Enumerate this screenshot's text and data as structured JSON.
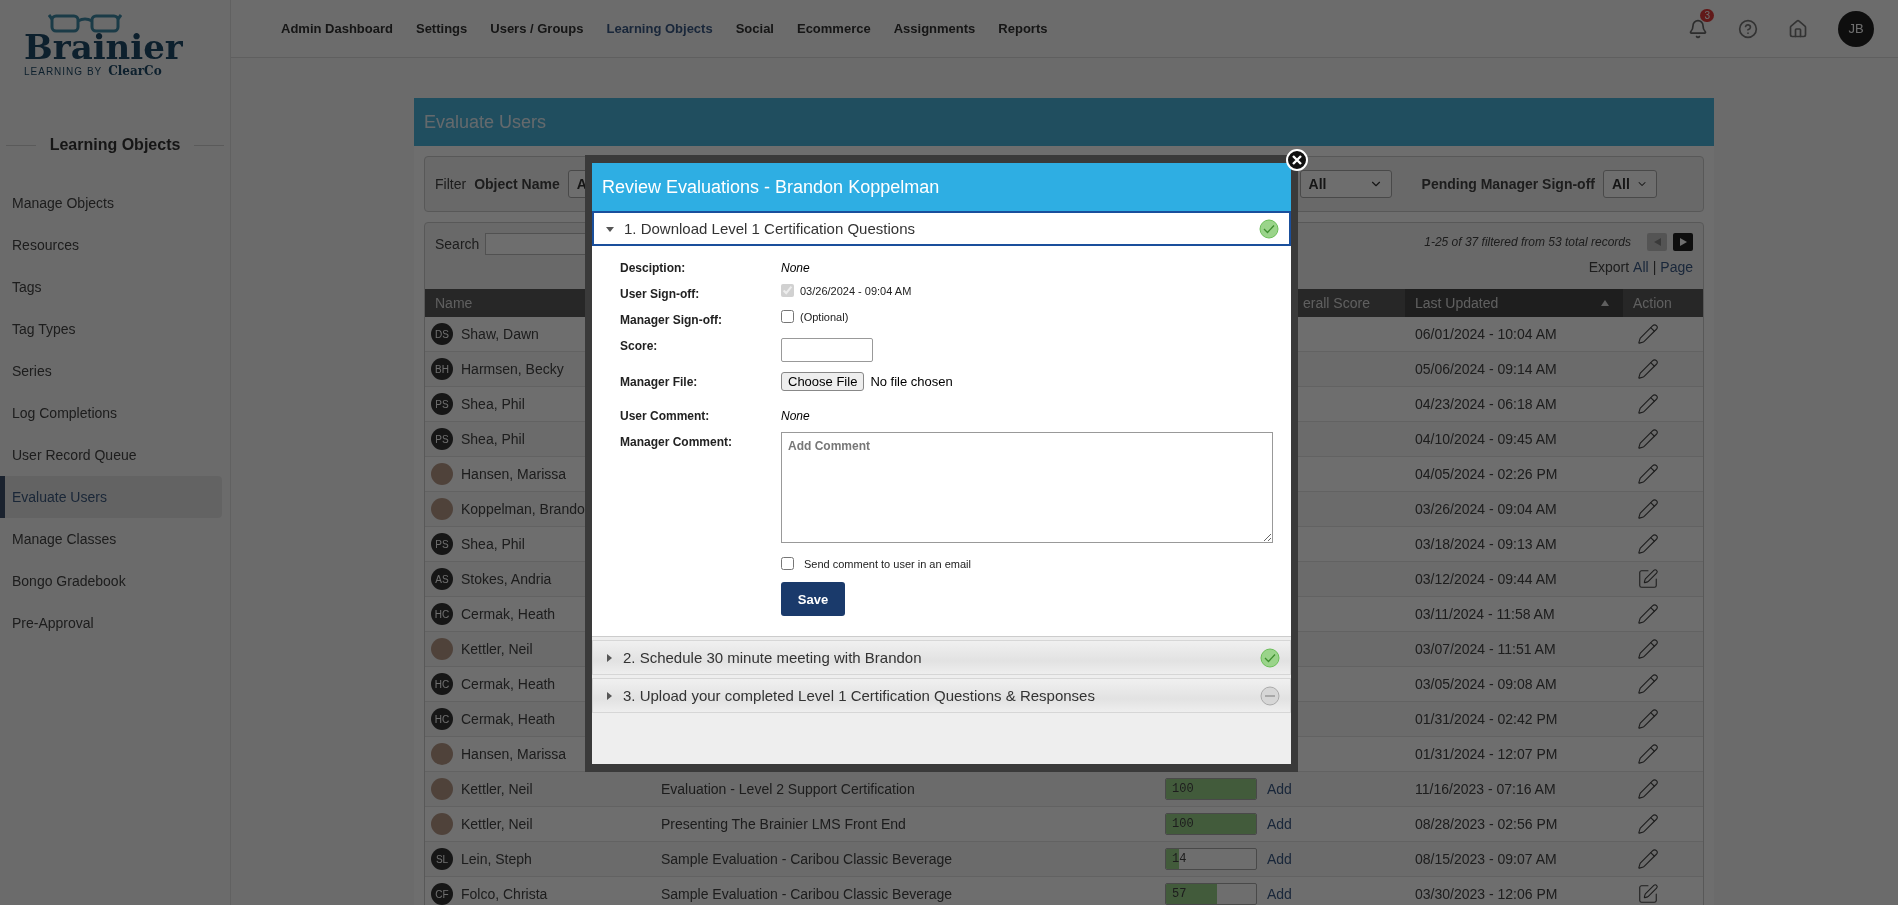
{
  "logo": {
    "name": "Brainier",
    "tagline": "LEARNING BY",
    "brand": "ClearCo"
  },
  "nav": [
    {
      "label": "Admin Dashboard",
      "selected": false
    },
    {
      "label": "Settings",
      "selected": false
    },
    {
      "label": "Users / Groups",
      "selected": false
    },
    {
      "label": "Learning Objects",
      "selected": true
    },
    {
      "label": "Social",
      "selected": false
    },
    {
      "label": "Ecommerce",
      "selected": false
    },
    {
      "label": "Assignments",
      "selected": false
    },
    {
      "label": "Reports",
      "selected": false
    }
  ],
  "topbar": {
    "notifications": "3",
    "user_initials": "JB"
  },
  "sidebar": {
    "heading": "Learning Objects",
    "items": [
      {
        "label": "Manage Objects",
        "selected": false
      },
      {
        "label": "Resources",
        "selected": false
      },
      {
        "label": "Tags",
        "selected": false
      },
      {
        "label": "Tag Types",
        "selected": false
      },
      {
        "label": "Series",
        "selected": false
      },
      {
        "label": "Log Completions",
        "selected": false
      },
      {
        "label": "User Record Queue",
        "selected": false
      },
      {
        "label": "Evaluate Users",
        "selected": true
      },
      {
        "label": "Manage Classes",
        "selected": false
      },
      {
        "label": "Bongo Gradebook",
        "selected": false
      },
      {
        "label": "Pre-Approval",
        "selected": false
      }
    ]
  },
  "panel": {
    "title": "Evaluate Users"
  },
  "filter": {
    "label": "Filter",
    "object_label": "Object Name",
    "object_value": "A",
    "status_value": "All",
    "pending_label": "Pending Manager Sign-off",
    "pending_value": "All"
  },
  "search": {
    "label": "Search"
  },
  "pager": {
    "summary": "1-25 of 37 filtered from 53 total records",
    "prev_disabled": true,
    "next_disabled": false
  },
  "export": {
    "label": "Export",
    "all": "All",
    "separator": "|",
    "page": "Page"
  },
  "table": {
    "columns": [
      "Name",
      "erall Score",
      "Last Updated",
      "Action"
    ],
    "rows": [
      {
        "name": "Shaw, Dawn",
        "avatar": {
          "kind": "initials",
          "text": "DS"
        },
        "updated": "06/01/2024 - 10:04 AM",
        "action": {
          "kind": "pencil"
        }
      },
      {
        "name": "Harmsen, Becky",
        "avatar": {
          "kind": "initials",
          "text": "BH"
        },
        "updated": "05/06/2024 - 09:14 AM",
        "action": {
          "kind": "pencil"
        }
      },
      {
        "name": "Shea, Phil",
        "avatar": {
          "kind": "initials",
          "text": "PS"
        },
        "updated": "04/23/2024 - 06:18 AM",
        "action": {
          "kind": "pencil"
        }
      },
      {
        "name": "Shea, Phil",
        "avatar": {
          "kind": "initials",
          "text": "PS"
        },
        "updated": "04/10/2024 - 09:45 AM",
        "action": {
          "kind": "pencil"
        }
      },
      {
        "name": "Hansen, Marissa",
        "avatar": {
          "kind": "photo"
        },
        "updated": "04/05/2024 - 02:26 PM",
        "action": {
          "kind": "pencil"
        }
      },
      {
        "name": "Koppelman, Brando",
        "avatar": {
          "kind": "photo"
        },
        "updated": "03/26/2024 - 09:04 AM",
        "action": {
          "kind": "pencil"
        }
      },
      {
        "name": "Shea, Phil",
        "avatar": {
          "kind": "initials",
          "text": "PS"
        },
        "updated": "03/18/2024 - 09:13 AM",
        "action": {
          "kind": "pencil"
        }
      },
      {
        "name": "Stokes, Andria",
        "avatar": {
          "kind": "initials",
          "text": "AS"
        },
        "updated": "03/12/2024 - 09:44 AM",
        "action": {
          "kind": "edit"
        }
      },
      {
        "name": "Cermak, Heath",
        "avatar": {
          "kind": "initials",
          "text": "HC"
        },
        "updated": "03/11/2024 - 11:58 AM",
        "action": {
          "kind": "pencil"
        }
      },
      {
        "name": "Kettler, Neil",
        "avatar": {
          "kind": "photo"
        },
        "updated": "03/07/2024 - 11:51 AM",
        "action": {
          "kind": "pencil"
        }
      },
      {
        "name": "Cermak, Heath",
        "avatar": {
          "kind": "initials",
          "text": "HC"
        },
        "updated": "03/05/2024 - 09:08 AM",
        "action": {
          "kind": "pencil"
        }
      },
      {
        "name": "Cermak, Heath",
        "avatar": {
          "kind": "initials",
          "text": "HC"
        },
        "updated": "01/31/2024 - 02:42 PM",
        "action": {
          "kind": "pencil"
        }
      },
      {
        "name": "Hansen, Marissa",
        "avatar": {
          "kind": "photo"
        },
        "updated": "01/31/2024 - 12:07 PM",
        "action": {
          "kind": "pencil"
        }
      },
      {
        "name": "Kettler, Neil",
        "avatar": {
          "kind": "photo"
        },
        "object": "Evaluation - Level 2 Support Certification",
        "score": "100",
        "level": 1,
        "add": "Add",
        "updated": "11/16/2023 - 07:16 AM",
        "action": {
          "kind": "pencil"
        }
      },
      {
        "name": "Kettler, Neil",
        "avatar": {
          "kind": "photo"
        },
        "object": "Presenting The Brainier LMS Front End",
        "score": "100",
        "level": 1,
        "add": "Add",
        "updated": "08/28/2023 - 02:56 PM",
        "action": {
          "kind": "pencil"
        }
      },
      {
        "name": "Lein, Steph",
        "avatar": {
          "kind": "initials",
          "text": "SL"
        },
        "object": "Sample Evaluation - Caribou Classic Beverage",
        "score": "14",
        "level": 0.14,
        "add": "Add",
        "updated": "08/15/2023 - 09:07 AM",
        "action": {
          "kind": "pencil"
        }
      },
      {
        "name": "Folco, Christa",
        "avatar": {
          "kind": "initials",
          "text": "CF"
        },
        "object": "Sample Evaluation - Caribou Classic Beverage",
        "score": "57",
        "level": 0.57,
        "add": "Add",
        "updated": "03/30/2023 - 12:06 PM",
        "action": {
          "kind": "edit"
        }
      }
    ]
  },
  "modal": {
    "title": "Review Evaluations - Brandon Koppelman",
    "sections": [
      {
        "title": "1. Download Level 1 Certification Questions",
        "expanded": true,
        "complete": true,
        "fields": [
          {
            "kind": "text",
            "label": "Desciption:",
            "value": "None"
          },
          {
            "kind": "checkbox",
            "label": "User Sign-off:",
            "checked": true,
            "disabled": true,
            "note": "03/26/2024 - 09:04 AM"
          },
          {
            "kind": "checkbox",
            "label": "Manager Sign-off:",
            "checked": false,
            "disabled": false,
            "note": "(Optional)"
          },
          {
            "kind": "input",
            "label": "Score:"
          },
          {
            "kind": "file",
            "label": "Manager File:",
            "button": "Choose File",
            "value": "No file chosen"
          },
          {
            "kind": "text",
            "label": "User Comment:",
            "value": "None"
          },
          {
            "kind": "textarea",
            "label": "Manager Comment:",
            "placeholder": "Add Comment"
          }
        ],
        "email": {
          "label": "Send comment to user in an email",
          "checked": false
        },
        "save": "Save"
      },
      {
        "title": "2. Schedule 30 minute meeting with Brandon",
        "expanded": false,
        "complete": true
      },
      {
        "title": "3. Upload your completed Level 1 Certification Questions & Responses",
        "expanded": false,
        "complete": false
      }
    ]
  }
}
